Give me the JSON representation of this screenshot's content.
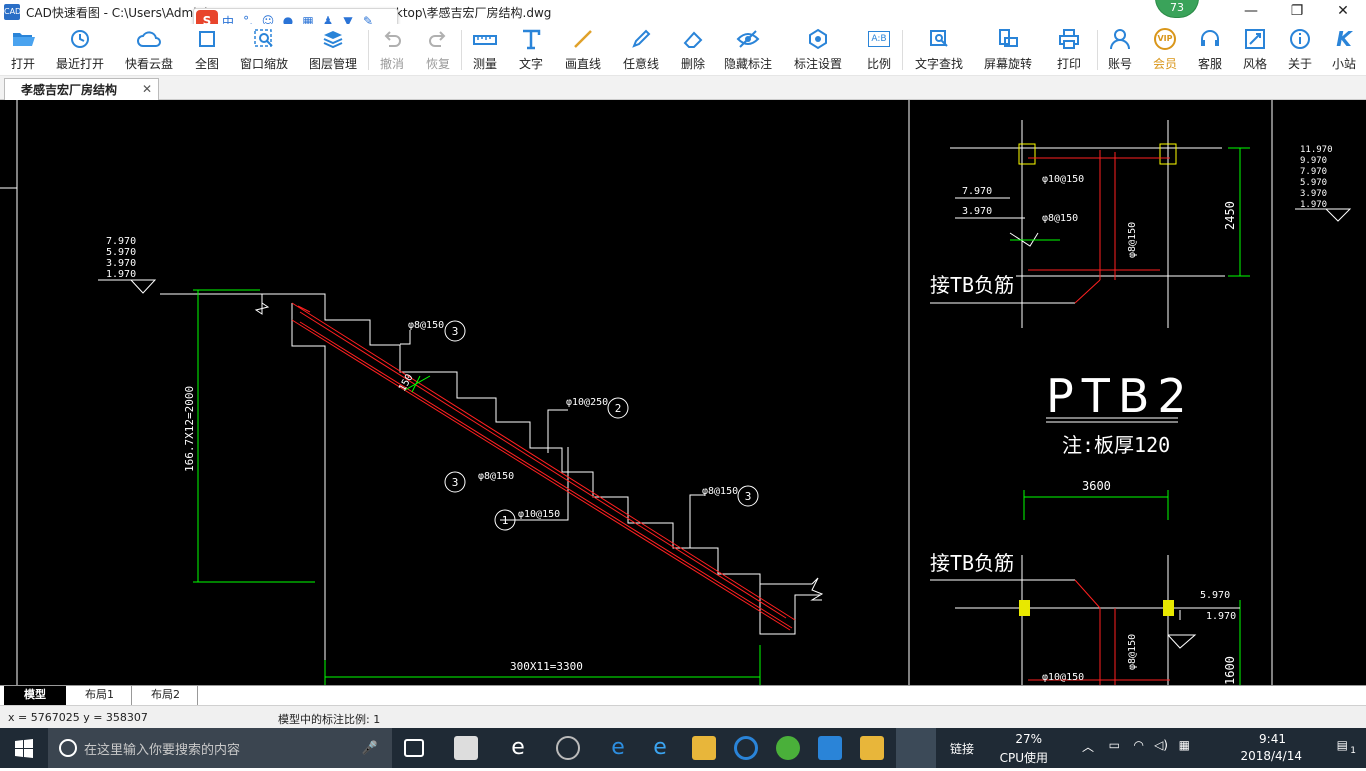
{
  "window": {
    "app_icon_text": "CAD",
    "title": "CAD快速看图 - C:\\Users\\Administrator-PC-20141127NRHM\\Desktop\\孝感吉宏厂房结构.dwg",
    "badge": "73",
    "controls": {
      "minimize": "—",
      "maximize": "❐",
      "close": "✕"
    }
  },
  "ime": {
    "logo": "S",
    "lang": "中",
    "punct": "°,"
  },
  "toolbar": {
    "open": "打开",
    "recent": "最近打开",
    "cloud": "快看云盘",
    "fit": "全图",
    "window_zoom": "窗口缩放",
    "layers": "图层管理",
    "undo": "撤消",
    "redo": "恢复",
    "measure": "测量",
    "text": "文字",
    "line": "画直线",
    "freehand": "任意线",
    "erase": "删除",
    "hide_dim": "隐藏标注",
    "dim_settings": "标注设置",
    "scale": "比例",
    "scale_icon": "A:B",
    "text_search": "文字查找",
    "rotate": "屏幕旋转",
    "print": "打印",
    "account": "账号",
    "member": "会员",
    "member_icon": "VIP",
    "service": "客服",
    "style": "风格",
    "about": "关于",
    "site": "小站",
    "site_icon": "K"
  },
  "tabs": {
    "document": "孝感吉宏厂房结构",
    "close": "✕"
  },
  "drawing": {
    "elev_left": [
      "7.970",
      "5.970",
      "3.970",
      "1.970"
    ],
    "dim_vertical": "166.7X12=2000",
    "dim_horizontal": "300X11=3300",
    "dim_150": "150",
    "rebar": [
      {
        "text": "φ8@150",
        "num": "3"
      },
      {
        "text": "φ10@250",
        "num": "2"
      },
      {
        "text": "φ8@150",
        "num": "3"
      },
      {
        "text": "φ10@150",
        "num": "1"
      },
      {
        "text": "φ8@150",
        "num": "3"
      }
    ],
    "right_top": {
      "elev1": "7.970",
      "elev2": "3.970",
      "r1": "φ10@150",
      "r2": "φ8@150",
      "r3": "φ8@150",
      "dim": "2450",
      "note": "接TB负筋"
    },
    "elev_far_right": [
      "11.970",
      "9.970",
      "7.970",
      "5.970",
      "3.970",
      "1.970"
    ],
    "ptb_title": "PTB2",
    "ptb_note": "注:板厚120",
    "right_bottom": {
      "dim": "3600",
      "note": "接TB负筋",
      "elev1": "5.970",
      "elev2": "1.970",
      "r1": "φ8@150",
      "r2": "φ10@150",
      "dim2": "1600"
    }
  },
  "layouts": {
    "model": "模型",
    "layout1": "布局1",
    "layout2": "布局2"
  },
  "status": {
    "coords": "x = 5767025  y = 358307",
    "scale": "模型中的标注比例: 1"
  },
  "taskbar": {
    "search_placeholder": "在这里输入你要搜索的内容",
    "tray_link": "链接",
    "cpu_pct": "27%",
    "cpu_label": "CPU使用",
    "time": "9:41",
    "date": "2018/4/14",
    "notif": "1"
  },
  "colors": {
    "canvas": "#000000",
    "white_line": "#ffffff",
    "green": "#00ff00",
    "red": "#ff2020",
    "yellow": "#ffff00"
  }
}
